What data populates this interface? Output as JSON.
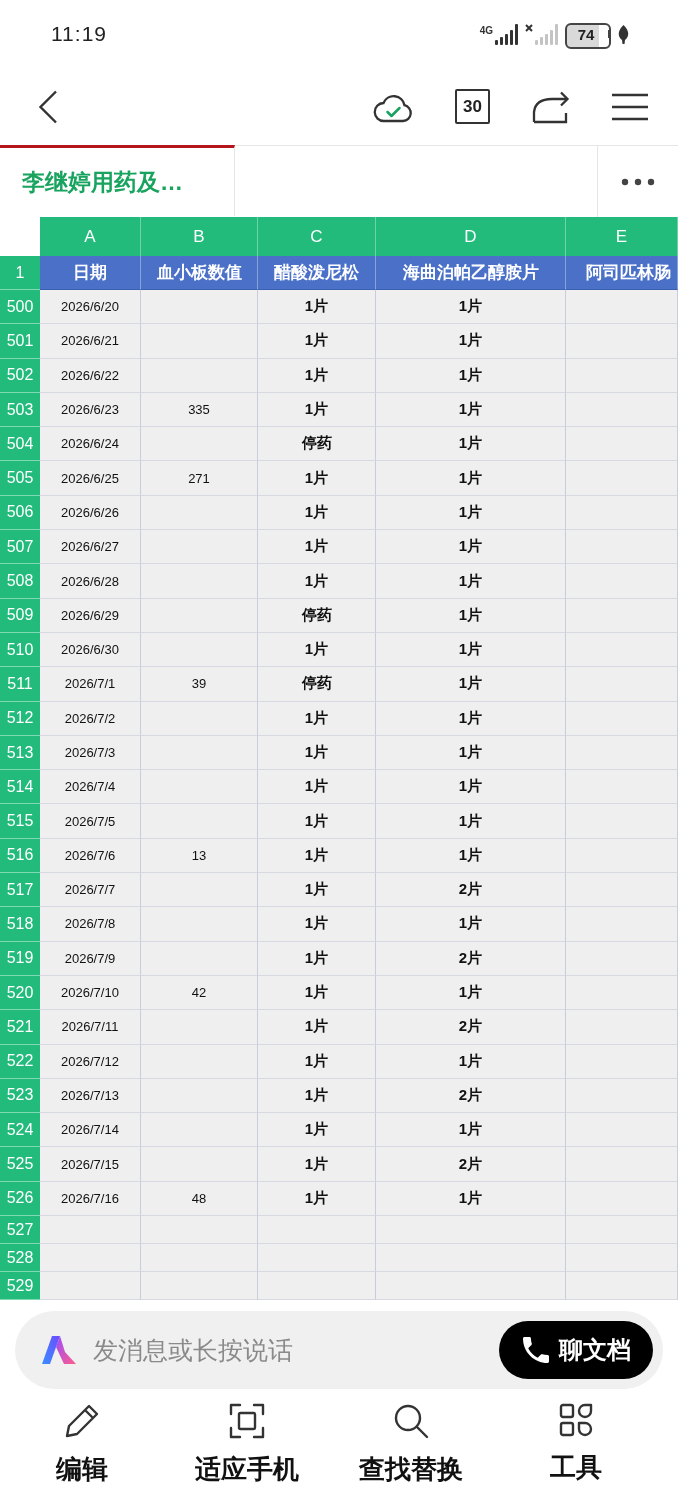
{
  "status_bar": {
    "time": "11:19",
    "network": "4G",
    "battery": "74"
  },
  "toolbar": {
    "counter": "30"
  },
  "sheet_tabs": [
    {
      "label": "李继婷用药及…",
      "selected": true
    }
  ],
  "sheet": {
    "columns": [
      "A",
      "B",
      "C",
      "D",
      "E"
    ],
    "header_row": {
      "row": "1",
      "cells": [
        "日期",
        "血小板数值",
        "醋酸泼尼松",
        "海曲泊帕乙醇胺片",
        "阿司匹林肠"
      ]
    },
    "rows": [
      {
        "row": "500",
        "date": "2026/6/20",
        "prednisone_acetate": "1片",
        "hetrombopag": "1片"
      },
      {
        "row": "501",
        "date": "2026/6/21",
        "prednisone_acetate": "1片",
        "hetrombopag": "1片"
      },
      {
        "row": "502",
        "date": "2026/6/22",
        "prednisone_acetate": "1片",
        "hetrombopag": "1片"
      },
      {
        "row": "503",
        "date": "2026/6/23",
        "platelet_count": "335",
        "prednisone_acetate": "1片",
        "hetrombopag": "1片"
      },
      {
        "row": "504",
        "date": "2026/6/24",
        "prednisone_acetate": "停药",
        "hetrombopag": "1片"
      },
      {
        "row": "505",
        "date": "2026/6/25",
        "platelet_count": "271",
        "prednisone_acetate": "1片",
        "hetrombopag": "1片"
      },
      {
        "row": "506",
        "date": "2026/6/26",
        "prednisone_acetate": "1片",
        "hetrombopag": "1片"
      },
      {
        "row": "507",
        "date": "2026/6/27",
        "prednisone_acetate": "1片",
        "hetrombopag": "1片"
      },
      {
        "row": "508",
        "date": "2026/6/28",
        "prednisone_acetate": "1片",
        "hetrombopag": "1片"
      },
      {
        "row": "509",
        "date": "2026/6/29",
        "prednisone_acetate": "停药",
        "hetrombopag": "1片"
      },
      {
        "row": "510",
        "date": "2026/6/30",
        "prednisone_acetate": "1片",
        "hetrombopag": "1片"
      },
      {
        "row": "511",
        "date": "2026/7/1",
        "platelet_count": "39",
        "prednisone_acetate": "停药",
        "hetrombopag": "1片"
      },
      {
        "row": "512",
        "date": "2026/7/2",
        "prednisone_acetate": "1片",
        "hetrombopag": "1片"
      },
      {
        "row": "513",
        "date": "2026/7/3",
        "prednisone_acetate": "1片",
        "hetrombopag": "1片"
      },
      {
        "row": "514",
        "date": "2026/7/4",
        "prednisone_acetate": "1片",
        "hetrombopag": "1片"
      },
      {
        "row": "515",
        "date": "2026/7/5",
        "prednisone_acetate": "1片",
        "hetrombopag": "1片"
      },
      {
        "row": "516",
        "date": "2026/7/6",
        "platelet_count": "13",
        "prednisone_acetate": "1片",
        "hetrombopag": "1片"
      },
      {
        "row": "517",
        "date": "2026/7/7",
        "prednisone_acetate": "1片",
        "hetrombopag": "2片"
      },
      {
        "row": "518",
        "date": "2026/7/8",
        "prednisone_acetate": "1片",
        "hetrombopag": "1片"
      },
      {
        "row": "519",
        "date": "2026/7/9",
        "prednisone_acetate": "1片",
        "hetrombopag": "2片"
      },
      {
        "row": "520",
        "date": "2026/7/10",
        "platelet_count": "42",
        "prednisone_acetate": "1片",
        "hetrombopag": "1片"
      },
      {
        "row": "521",
        "date": "2026/7/11",
        "prednisone_acetate": "1片",
        "hetrombopag": "2片"
      },
      {
        "row": "522",
        "date": "2026/7/12",
        "prednisone_acetate": "1片",
        "hetrombopag": "1片"
      },
      {
        "row": "523",
        "date": "2026/7/13",
        "prednisone_acetate": "1片",
        "hetrombopag": "2片"
      },
      {
        "row": "524",
        "date": "2026/7/14",
        "prednisone_acetate": "1片",
        "hetrombopag": "1片"
      },
      {
        "row": "525",
        "date": "2026/7/15",
        "prednisone_acetate": "1片",
        "hetrombopag": "2片"
      },
      {
        "row": "526",
        "date": "2026/7/16",
        "platelet_count": "48",
        "prednisone_acetate": "1片",
        "hetrombopag": "1片"
      },
      {
        "row": "527"
      },
      {
        "row": "528"
      },
      {
        "row": "529"
      }
    ]
  },
  "message_bar": {
    "placeholder": "发消息或长按说话",
    "button": "聊文档"
  },
  "bottom_nav": [
    {
      "label": "编辑"
    },
    {
      "label": "适应手机"
    },
    {
      "label": "查找替换"
    },
    {
      "label": "工具"
    }
  ]
}
